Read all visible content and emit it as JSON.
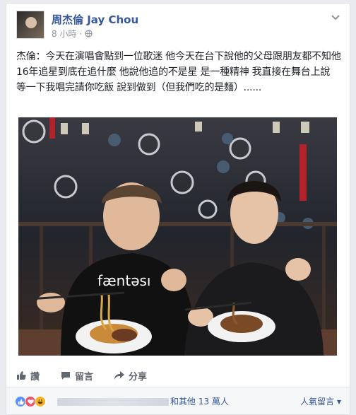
{
  "post": {
    "author": "周杰倫 Jay Chou",
    "time": "8 小時",
    "separator": "·",
    "text": "杰倫：今天在演唱會點到一位歌迷 他今天在台下說他的父母跟朋友都不知他16年追星到底在追什麼 他說他追的不是星 是一種精神 我直接在舞台上說 等一下我唱完請你吃飯 說到做到（但我們吃的是麵）......",
    "photo_caption": "fæntəsı"
  },
  "actions": {
    "like": "讚",
    "comment": "留言",
    "share": "分享"
  },
  "reactions": {
    "count_text": "和其他 13 萬人",
    "sort_label": "人氣留言 ▾"
  },
  "colors": {
    "link": "#365899",
    "meta": "#90949c",
    "like_blue": "#5890ff",
    "love_red": "#f25268",
    "haha_yellow": "#f7b125"
  }
}
